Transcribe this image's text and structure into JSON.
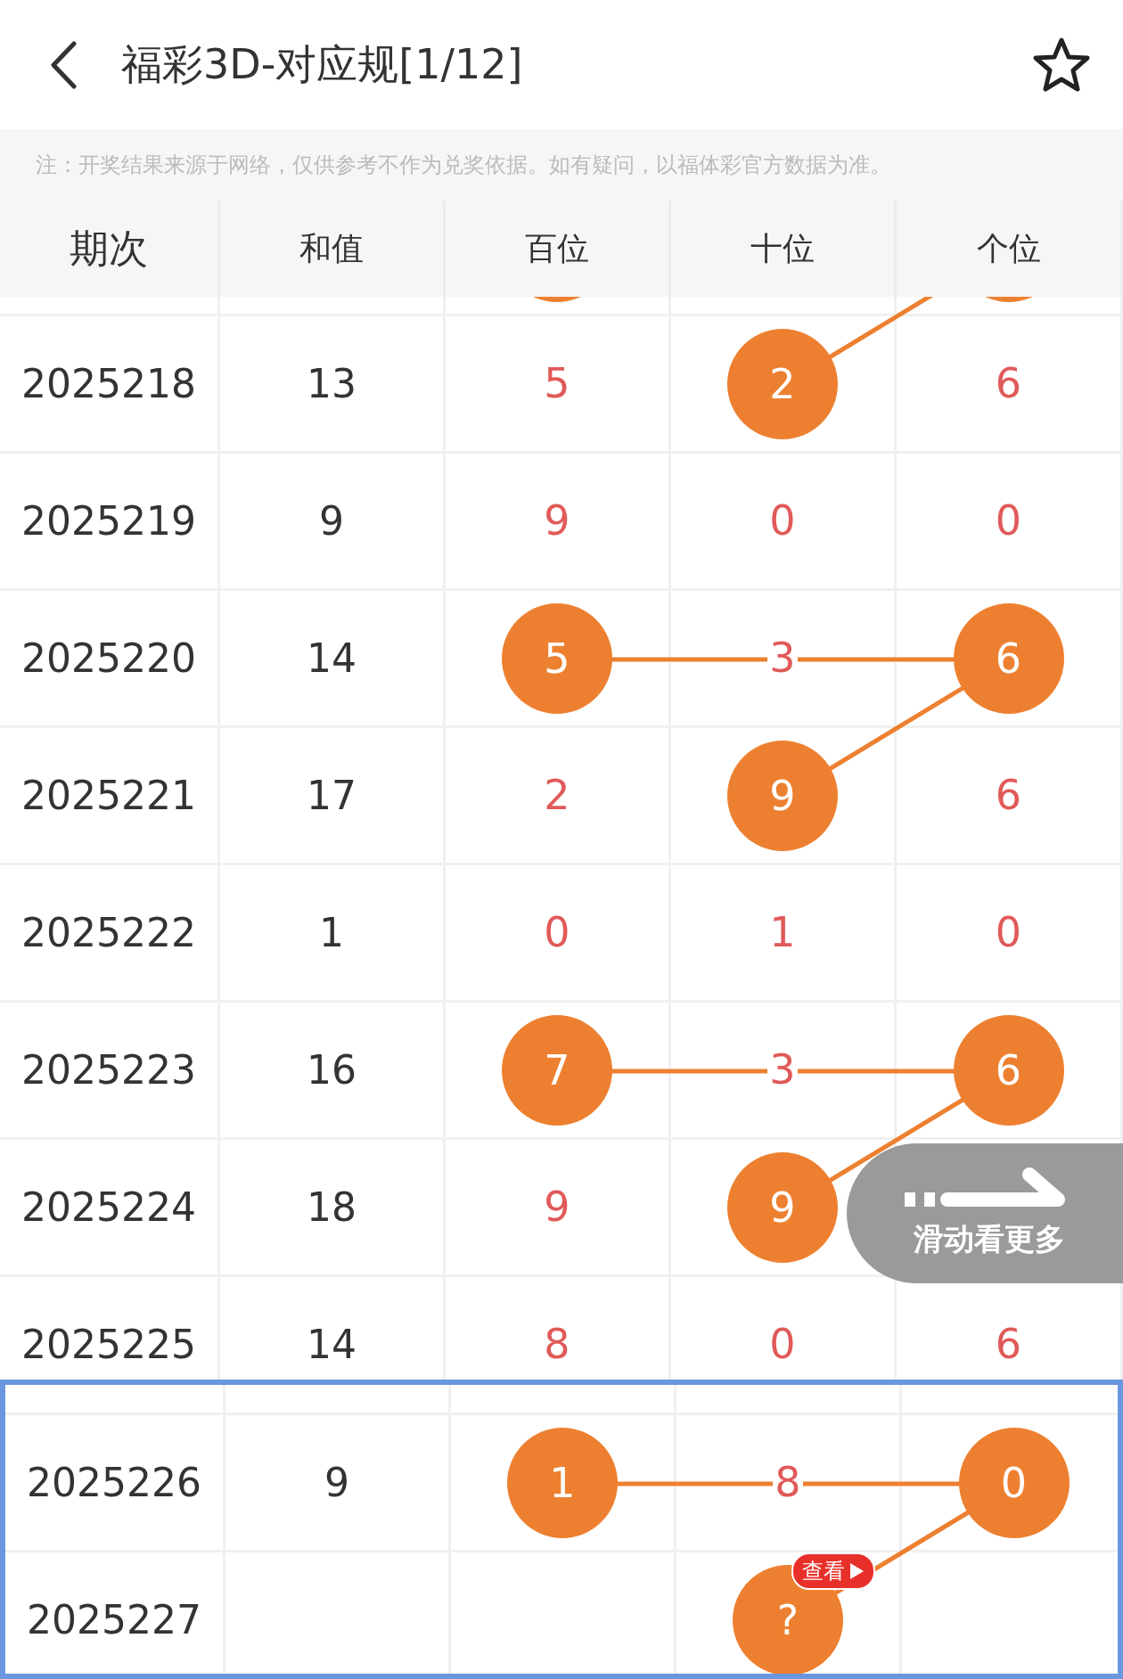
{
  "header": {
    "title": "福彩3D-对应规[1/12]"
  },
  "notice": "注：开奖结果来源于网络，仅供参考不作为兑奖依据。如有疑问，以福体彩官方数据为准。",
  "columns": [
    "期次",
    "和值",
    "百位",
    "十位",
    "个位"
  ],
  "rows": [
    {
      "cells": [
        {
          "circled": true
        },
        {},
        {
          "circled": true
        }
      ]
    },
    {
      "period": "2025218",
      "sum": "13",
      "cells": [
        {
          "value": "5",
          "circled": false
        },
        {
          "value": "2",
          "circled": true
        },
        {
          "value": "6",
          "circled": false
        }
      ]
    },
    {
      "period": "2025219",
      "sum": "9",
      "cells": [
        {
          "value": "9",
          "circled": false
        },
        {
          "value": "0",
          "circled": false
        },
        {
          "value": "0",
          "circled": false
        }
      ]
    },
    {
      "period": "2025220",
      "sum": "14",
      "cells": [
        {
          "value": "5",
          "circled": true
        },
        {
          "value": "3",
          "circled": false
        },
        {
          "value": "6",
          "circled": true
        }
      ]
    },
    {
      "period": "2025221",
      "sum": "17",
      "cells": [
        {
          "value": "2",
          "circled": false
        },
        {
          "value": "9",
          "circled": true
        },
        {
          "value": "6",
          "circled": false
        }
      ]
    },
    {
      "period": "2025222",
      "sum": "1",
      "cells": [
        {
          "value": "0",
          "circled": false
        },
        {
          "value": "1",
          "circled": false
        },
        {
          "value": "0",
          "circled": false
        }
      ]
    },
    {
      "period": "2025223",
      "sum": "16",
      "cells": [
        {
          "value": "7",
          "circled": true
        },
        {
          "value": "3",
          "circled": false
        },
        {
          "value": "6",
          "circled": true
        }
      ]
    },
    {
      "period": "2025224",
      "sum": "18",
      "cells": [
        {
          "value": "9",
          "circled": false
        },
        {
          "value": "9",
          "circled": true
        },
        {}
      ]
    },
    {
      "period": "2025225",
      "sum": "14",
      "cells": [
        {
          "value": "8",
          "circled": false
        },
        {
          "value": "0",
          "circled": false
        },
        {
          "value": "6",
          "circled": false
        }
      ]
    }
  ],
  "highlighted_rows": [
    {
      "period": "2025226",
      "sum": "9",
      "cells": [
        {
          "value": "1",
          "circled": true
        },
        {
          "value": "8",
          "circled": false
        },
        {
          "value": "0",
          "circled": true
        }
      ]
    },
    {
      "period": "2025227",
      "cells": [
        {},
        {
          "value": "?",
          "circled": true,
          "badge": "查看"
        },
        {}
      ]
    }
  ],
  "swipe_hint": "滑动看更多"
}
